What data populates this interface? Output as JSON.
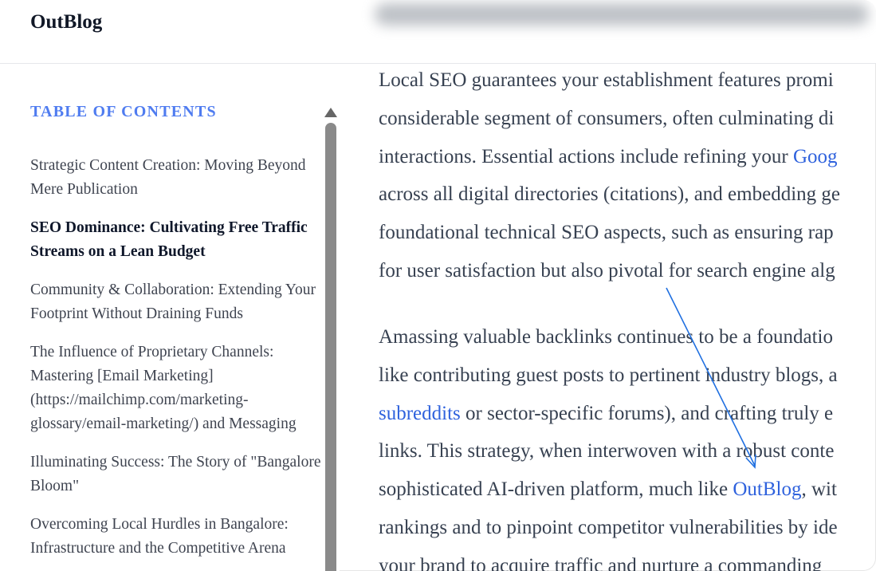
{
  "app": {
    "logo": "OutBlog"
  },
  "toc": {
    "title": "TABLE OF CONTENTS",
    "items": [
      {
        "label": "Strategic Content Creation: Moving Beyond Mere Publication",
        "active": false
      },
      {
        "label": "SEO Dominance: Cultivating Free Traffic Streams on a Lean Budget",
        "active": true
      },
      {
        "label": "Community & Collaboration: Extending Your Footprint Without Draining Funds",
        "active": false
      },
      {
        "label": "The Influence of Proprietary Channels: Mastering [Email Marketing] (https://mailchimp.com/marketing-glossary/email-marketing/) and Messaging",
        "active": false
      },
      {
        "label": "Illuminating Success: The Story of \"Bangalore Bloom\"",
        "active": false
      },
      {
        "label": "Overcoming Local Hurdles in Bangalore: Infrastructure and the Competitive Arena",
        "active": false
      }
    ]
  },
  "article": {
    "p1": {
      "l1": "Local SEO guarantees your establishment features promi",
      "l2": "considerable segment of consumers, often culminating di",
      "l3_pre": "interactions. Essential actions include refining your ",
      "l3_link": "Goog",
      "l4": "across all digital directories (citations), and embedding ge",
      "l5": "foundational technical SEO aspects, such as ensuring rap",
      "l6": "for user satisfaction but also pivotal for search engine alg"
    },
    "p2": {
      "l1": "Amassing valuable backlinks continues to be a foundatio",
      "l2": "like contributing guest posts to pertinent industry blogs, a",
      "l3_link": "subreddits",
      "l3_post": " or sector-specific forums), and crafting truly e",
      "l4": "links. This strategy, when interwoven with a robust conte",
      "l5_pre": "sophisticated AI-driven platform, much like ",
      "l5_link": "OutBlog",
      "l5_post": ", wit",
      "l6": "rankings and to pinpoint competitor vulnerabilities by ide",
      "l7": "your brand to acquire traffic and nurture a commanding "
    }
  },
  "colors": {
    "accent": "#4f7cf0",
    "link": "#2f62dd",
    "text": "#374151",
    "arrow": "#1f6fe0"
  }
}
